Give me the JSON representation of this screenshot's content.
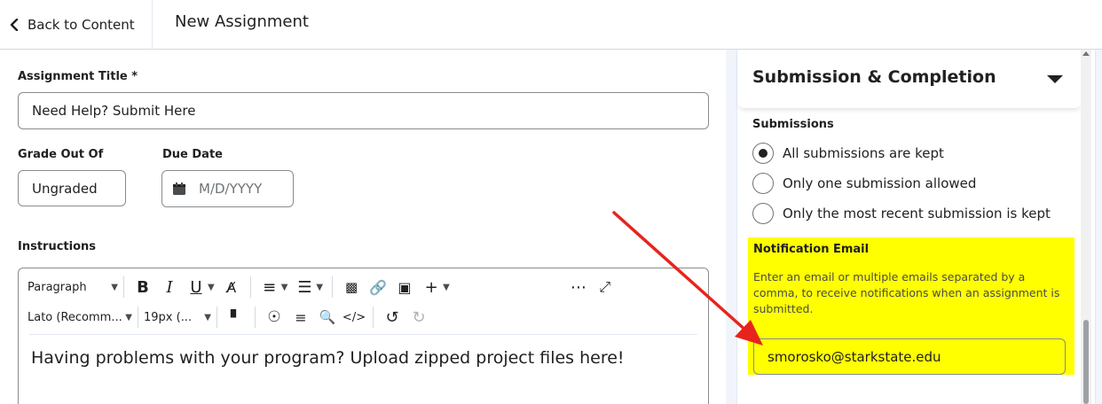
{
  "topbar": {
    "back_label": "Back to Content",
    "title": "New Assignment"
  },
  "form": {
    "title_label": "Assignment Title *",
    "title_value": "Need Help? Submit Here",
    "grade_label": "Grade Out Of",
    "grade_value": "Ungraded",
    "due_label": "Due Date",
    "due_placeholder": "M/D/YYYY",
    "instructions_label": "Instructions"
  },
  "editor": {
    "block_format": "Paragraph",
    "font_family": "Lato (Recomm...",
    "font_size": "19px (...",
    "content": "Having problems with your program? Upload zipped project files here!",
    "icons": [
      "bold-icon",
      "italic-icon",
      "underline-icon",
      "format-icon",
      "align-icon",
      "list-icon",
      "insert-stuff-icon",
      "link-icon",
      "image-icon",
      "plus-icon",
      "more-icon",
      "fullscreen-icon",
      "format-painter-icon",
      "accessibility-icon",
      "word-count-icon",
      "find-replace-icon",
      "source-code-icon",
      "undo-icon",
      "redo-icon"
    ]
  },
  "sidebar": {
    "section_title": "Submission & Completion",
    "submissions_label": "Submissions",
    "options": [
      {
        "label": "All submissions are kept",
        "selected": true
      },
      {
        "label": "Only one submission allowed",
        "selected": false
      },
      {
        "label": "Only the most recent submission is kept",
        "selected": false
      }
    ],
    "notification": {
      "title": "Notification Email",
      "description": "Enter an email or multiple emails separated by a comma, to receive notifications when an assignment is submitted.",
      "value": "smorosko@starkstate.edu"
    }
  },
  "colors": {
    "highlight": "#ffff00",
    "annotation_arrow": "#e8231c",
    "text": "#202122",
    "border": "#868c8f"
  }
}
